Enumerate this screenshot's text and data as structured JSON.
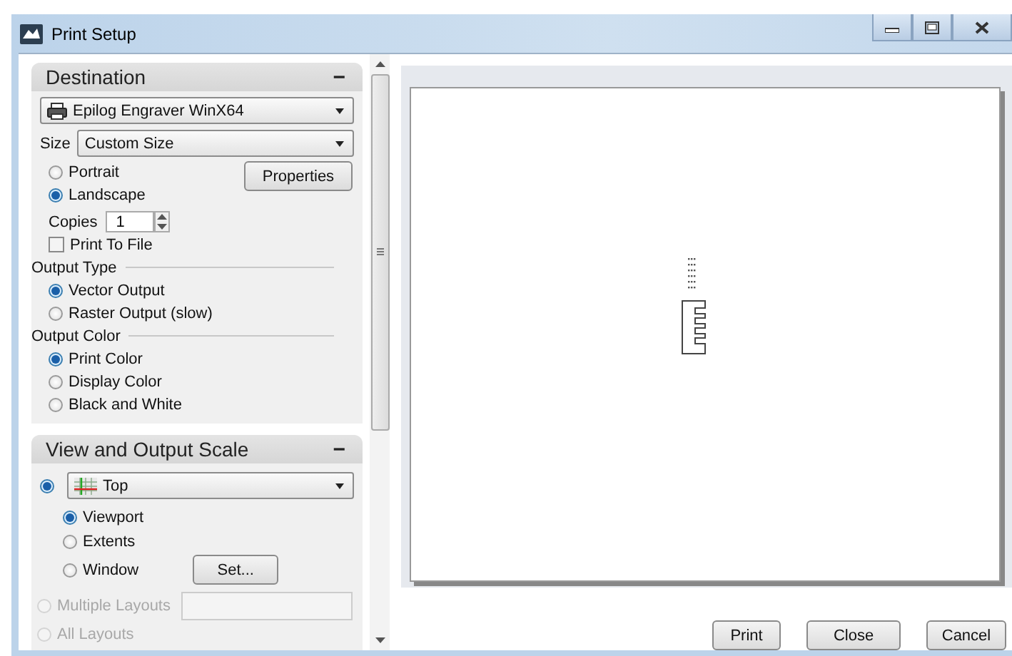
{
  "window": {
    "title": "Print Setup"
  },
  "destination": {
    "header": "Destination",
    "collapse": "−",
    "printer": "Epilog Engraver WinX64",
    "size_label": "Size",
    "size_value": "Custom Size",
    "orientation": [
      {
        "label": "Portrait",
        "selected": false
      },
      {
        "label": "Landscape",
        "selected": true
      }
    ],
    "properties_button": "Properties",
    "copies_label": "Copies",
    "copies_value": "1",
    "print_to_file": {
      "label": "Print To File",
      "checked": false
    },
    "output_type": {
      "label": "Output Type",
      "options": [
        {
          "label": "Vector Output",
          "selected": true
        },
        {
          "label": "Raster Output (slow)",
          "selected": false
        }
      ]
    },
    "output_color": {
      "label": "Output Color",
      "options": [
        {
          "label": "Print Color",
          "selected": true
        },
        {
          "label": "Display Color",
          "selected": false
        },
        {
          "label": "Black and White",
          "selected": false
        }
      ]
    }
  },
  "view_scale": {
    "header": "View and Output Scale",
    "collapse": "−",
    "view_selected": true,
    "view_value": "Top",
    "options": [
      {
        "label": "Viewport",
        "selected": true
      },
      {
        "label": "Extents",
        "selected": false
      },
      {
        "label": "Window",
        "selected": false
      }
    ],
    "set_button": "Set...",
    "layouts": [
      {
        "label": "Multiple Layouts",
        "selected": false,
        "disabled": true
      },
      {
        "label": "All Layouts",
        "selected": false,
        "disabled": true
      }
    ]
  },
  "buttons": [
    "Print",
    "Close",
    "Cancel"
  ]
}
